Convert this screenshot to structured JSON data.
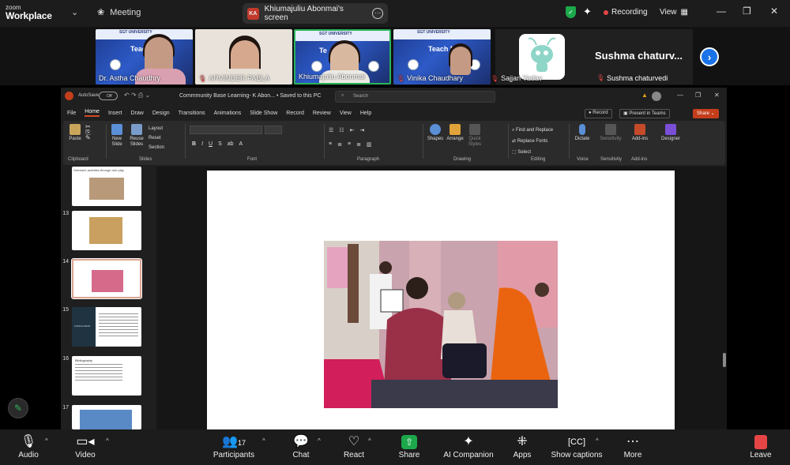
{
  "app": {
    "logo_line1": "zoom",
    "logo_line2": "Workplace",
    "meeting_label": "Meeting",
    "share_pill_initials": "KA",
    "share_pill_text": "Khiumajuliu Abonmai's screen",
    "recording_label": "Recording",
    "view_label": "View"
  },
  "participants_strip": [
    {
      "name": "Dr. Astha Chaudhry",
      "muted": false
    },
    {
      "name": "ARVINDER PABLA",
      "muted": true
    },
    {
      "name": "Khiumajuliu Abonmai",
      "muted": false,
      "active": true
    },
    {
      "name": "Vinika Chaudhary",
      "muted": true
    },
    {
      "name": "Sajjan Yadav",
      "muted": true
    },
    {
      "name": "Sushma chaturvedi",
      "muted": true,
      "big_label": "Sushma  chaturv..."
    }
  ],
  "ppt": {
    "autosave_label": "AutoSave",
    "autosave_state": "Off",
    "doc_title": "Commmunity Base Learning- K Abon... • Saved to this PC",
    "search_placeholder": "Search",
    "menu": [
      "File",
      "Home",
      "Insert",
      "Draw",
      "Design",
      "Transitions",
      "Animations",
      "Slide Show",
      "Record",
      "Review",
      "View",
      "Help"
    ],
    "active_menu": "Home",
    "record_btn": "Record",
    "present_btn": "Present in Teams",
    "share_btn": "Share",
    "ribbon": {
      "paste": "Paste",
      "clipboard": "Clipboard",
      "new_slide": "New Slide",
      "reuse_slides": "Reuse Slides",
      "layout": "Layout",
      "reset": "Reset",
      "section": "Section",
      "slides": "Slides",
      "font": "Font",
      "paragraph": "Paragraph",
      "shapes": "Shapes",
      "arrange": "Arrange",
      "quick_styles": "Quick Styles",
      "drawing": "Drawing",
      "find_replace": "Find and Replace",
      "replace_fonts": "Replace Fonts",
      "select": "Select",
      "editing": "Editing",
      "dictate": "Dictate",
      "voice": "Voice",
      "sensitivity": "Sensitivity",
      "addins": "Add-ins",
      "designer": "Designer"
    },
    "thumb_caption_12": "Outreach activities through role play",
    "thumb_title_15": "CONCLUSION",
    "thumb_title_16": "Bibliography",
    "thumbs": [
      "13",
      "14",
      "15",
      "16",
      "17"
    ]
  },
  "bottom": {
    "audio": "Audio",
    "video": "Video",
    "participants": "Participants",
    "participant_count": "17",
    "chat": "Chat",
    "react": "React",
    "share": "Share",
    "ai": "AI Companion",
    "apps": "Apps",
    "captions": "Show captions",
    "more": "More",
    "leave": "Leave"
  },
  "colors": {
    "zoom_blue": "#1a73e8",
    "share_green": "#1ca84b",
    "recording_red": "#e64545",
    "ppt_orange": "#c43e1c"
  }
}
